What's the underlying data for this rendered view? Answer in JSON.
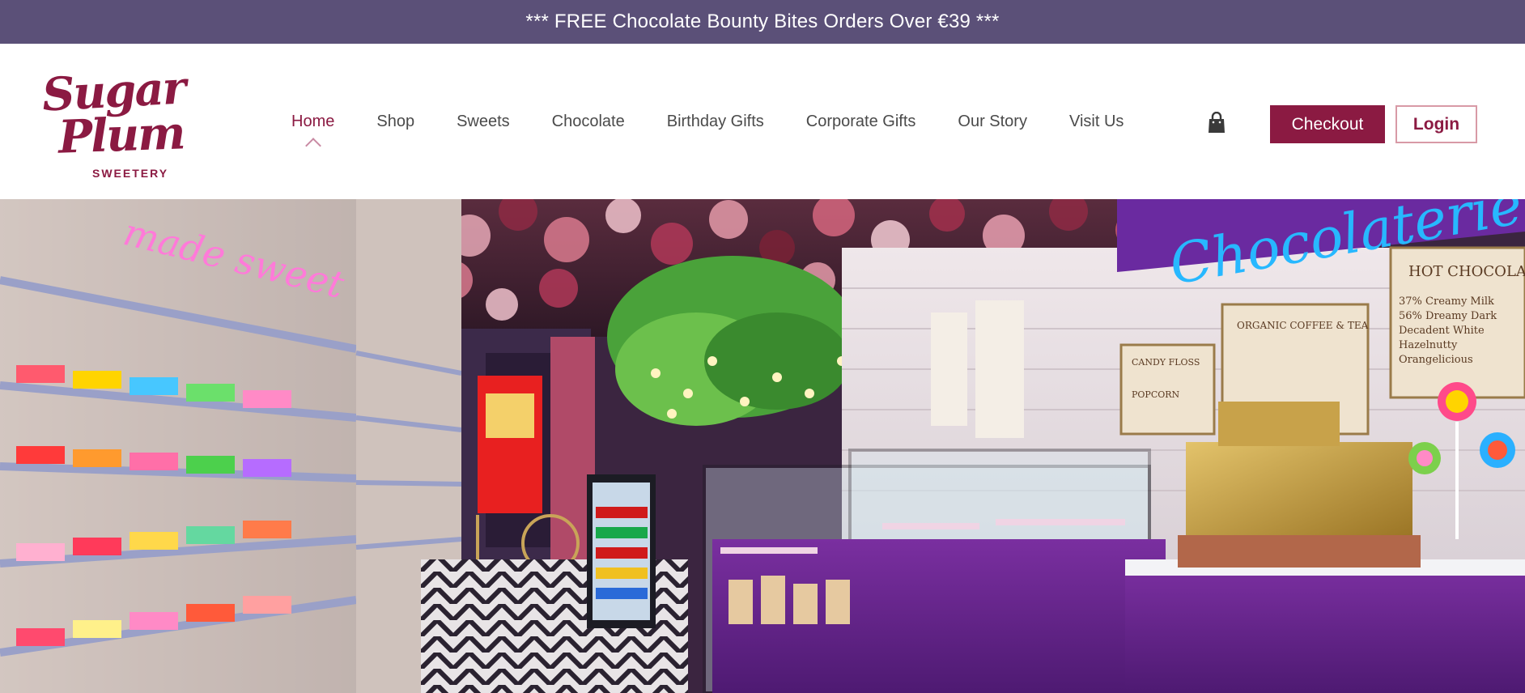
{
  "announcement": {
    "text": "*** FREE Chocolate Bounty Bites Orders Over €39 ***"
  },
  "logo": {
    "line1": "Sugar",
    "line2": "Plum",
    "tagline": "SWEETERY"
  },
  "nav": {
    "items": [
      {
        "label": "Home",
        "active": true
      },
      {
        "label": "Shop"
      },
      {
        "label": "Sweets"
      },
      {
        "label": "Chocolate"
      },
      {
        "label": "Birthday Gifts"
      },
      {
        "label": "Corporate Gifts"
      },
      {
        "label": "Our Story"
      },
      {
        "label": "Visit Us"
      }
    ],
    "cart_icon": "shopping-bag-icon",
    "checkout_label": "Checkout",
    "login_label": "Login"
  },
  "hero": {
    "neon_left": "made sweet",
    "neon_right": "Chocolaterie",
    "menu_board_title": "HOT CHOCOLATE",
    "menu_board_items": [
      "37% Creamy Milk",
      "56% Dreamy Dark",
      "Decadent White",
      "Hazelnutty",
      "Orangelicious"
    ],
    "board_sections": [
      "ORGANIC COFFEE & TEA",
      "CANDY FLOSS",
      "POPCORN"
    ]
  },
  "colors": {
    "topbar": "#5b5078",
    "brand": "#8b1a42",
    "login_border": "#d89aa6",
    "nav_text": "#4a4a4a"
  }
}
